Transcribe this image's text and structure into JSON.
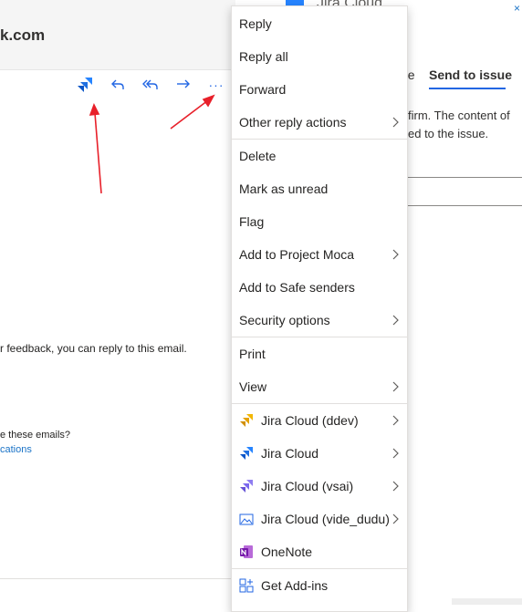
{
  "header": {
    "sender_fragment": "k.com"
  },
  "toolbar": {
    "icons": [
      "jira-addin-icon",
      "reply-icon",
      "reply-all-icon",
      "forward-icon",
      "more-actions-icon"
    ],
    "more_label": "···"
  },
  "email_body": {
    "feedback_line": "r feedback, you can reply to this email.",
    "question_line": "e these emails?",
    "link_fragment": "cations"
  },
  "right_pane": {
    "title_fragment": "Jira Cloud",
    "close_glyph": "×",
    "tabs": [
      {
        "label": "ue",
        "selected": false
      },
      {
        "label": "Send to issue",
        "selected": true
      }
    ],
    "desc_line1": "firm. The content of",
    "desc_line2": "ed to the issue."
  },
  "menu": {
    "items": [
      {
        "label": "Reply",
        "submenu": false
      },
      {
        "label": "Reply all",
        "submenu": false
      },
      {
        "label": "Forward",
        "submenu": false
      },
      {
        "label": "Other reply actions",
        "submenu": true
      },
      {
        "label": "Delete",
        "submenu": false
      },
      {
        "label": "Mark as unread",
        "submenu": false
      },
      {
        "label": "Flag",
        "submenu": false
      },
      {
        "label": "Add to Project Moca",
        "submenu": true
      },
      {
        "label": "Add to Safe senders",
        "submenu": false
      },
      {
        "label": "Security options",
        "submenu": true
      },
      {
        "label": "Print",
        "submenu": false
      },
      {
        "label": "View",
        "submenu": true
      },
      {
        "label": "Jira Cloud (ddev)",
        "submenu": true,
        "icon": "jira-ddev-icon"
      },
      {
        "label": "Jira Cloud",
        "submenu": true,
        "icon": "jira-cloud-icon"
      },
      {
        "label": "Jira Cloud (vsai)",
        "submenu": true,
        "icon": "jira-vsai-icon"
      },
      {
        "label": "Jira Cloud (vide_dudu)",
        "submenu": true,
        "icon": "image-placeholder-icon"
      },
      {
        "label": "OneNote",
        "submenu": false,
        "icon": "onenote-icon"
      },
      {
        "label": "Get Add-ins",
        "submenu": false,
        "icon": "add-ins-icon"
      }
    ]
  },
  "colors": {
    "accent": "#2266e3",
    "link": "#1a73c7",
    "annotation_arrow": "#e8202a",
    "jira_blue": "#2684ff",
    "jira_yellow": "#f2b705",
    "jira_purple": "#7b68ee",
    "onenote_purple": "#7719aa"
  }
}
